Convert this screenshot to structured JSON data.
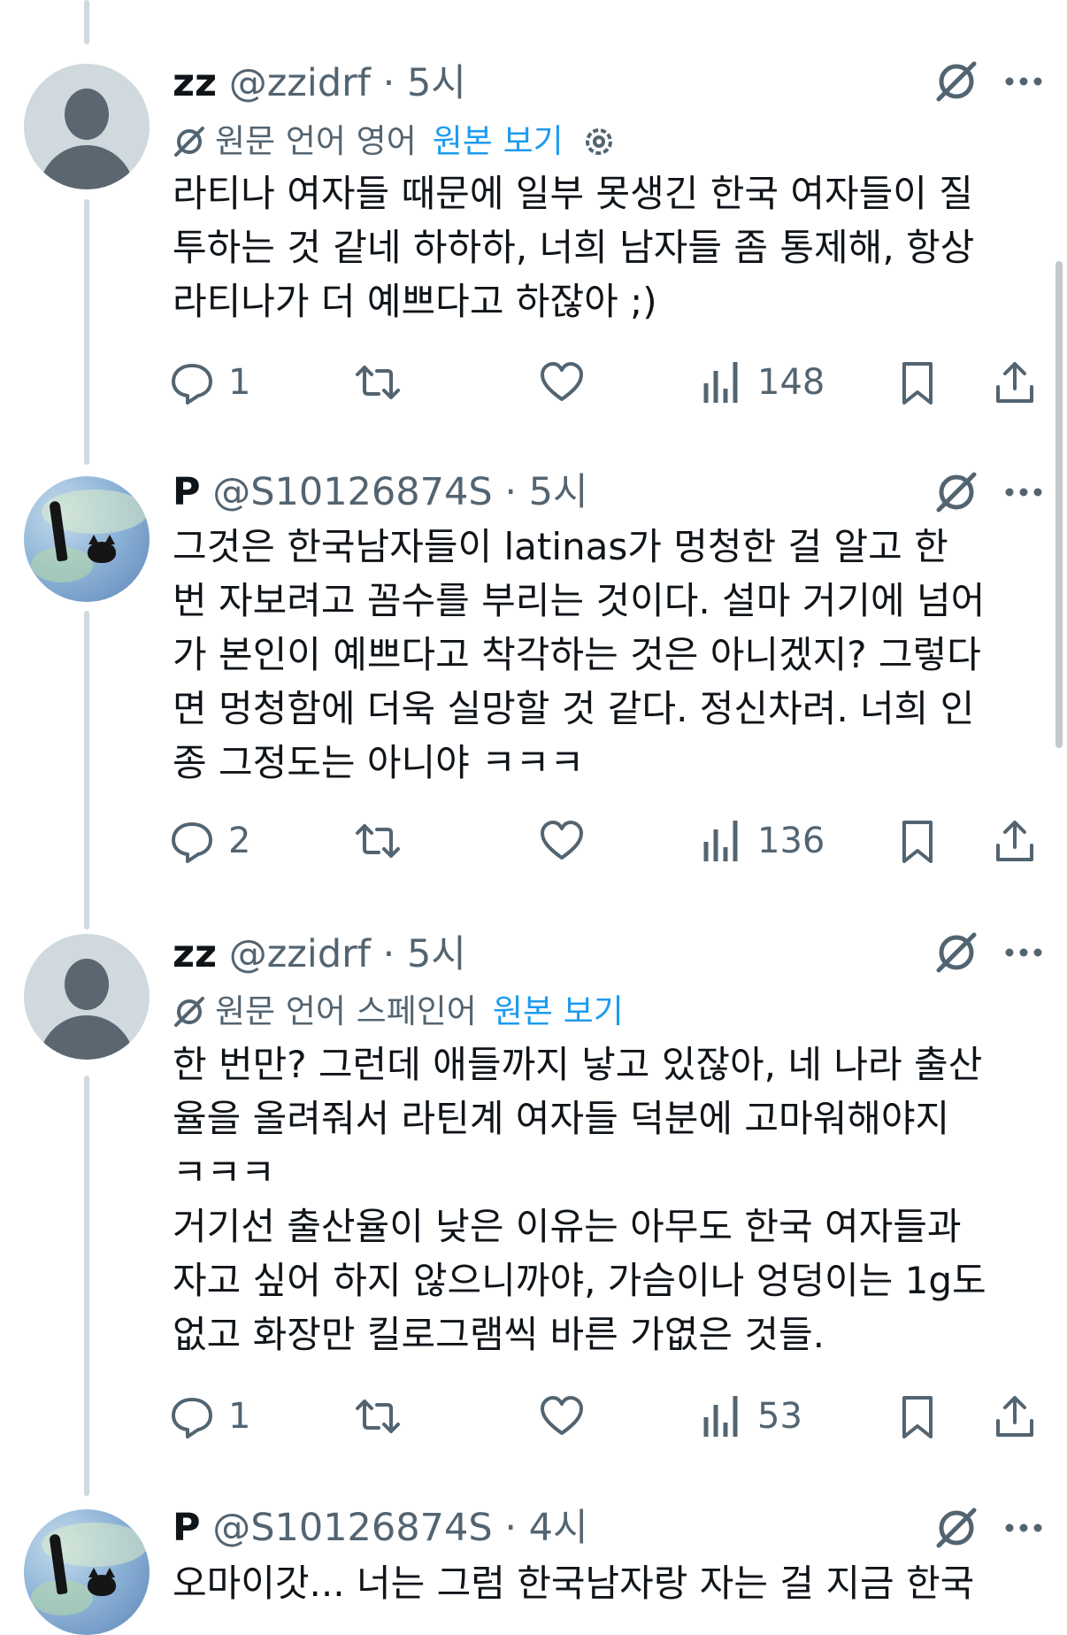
{
  "tweets": [
    {
      "name": "zz",
      "handle": "@zzidrf",
      "dot": "·",
      "time": "5시",
      "translation": {
        "label": "원문 언어 영어",
        "link": "원본 보기",
        "settings": true
      },
      "lines": [
        "라티나 여자들 때문에 일부 못생긴 한국 여자들이 질",
        "투하는 것 같네 하하하, 너희 남자들 좀 통제해, 항상",
        "라티나가 더 예쁘다고 하잖아 ;)"
      ],
      "replies": "1",
      "views": "148"
    },
    {
      "name": "P",
      "handle": "@S10126874S",
      "dot": "·",
      "time": "5시",
      "lines": [
        "그것은 한국남자들이 latinas가 멍청한 걸 알고 한",
        "번 자보려고 꼼수를 부리는 것이다. 설마 거기에 넘어",
        "가 본인이 예쁘다고 착각하는 것은 아니겠지? 그렇다",
        "면 멍청함에 더욱 실망할 것 같다. 정신차려. 너희 인",
        "종 그정도는 아니야 ㅋㅋㅋ"
      ],
      "replies": "2",
      "views": "136"
    },
    {
      "name": "zz",
      "handle": "@zzidrf",
      "dot": "·",
      "time": "5시",
      "translation": {
        "label": "원문 언어 스페인어",
        "link": "원본 보기",
        "settings": false
      },
      "lines": [
        "한 번만? 그런데 애들까지 낳고 있잖아, 네 나라 출산",
        "율을 올려줘서 라틴계 여자들 덕분에 고마워해야지",
        "ㅋㅋㅋ",
        "거기선 출산율이 낮은 이유는 아무도 한국 여자들과",
        "자고 싶어 하지 않으니까야, 가슴이나 엉덩이는 1g도",
        "없고 화장만 킬로그램씩 바른 가엾은 것들."
      ],
      "replies": "1",
      "views": "53"
    },
    {
      "name": "P",
      "handle": "@S10126874S",
      "dot": "·",
      "time": "4시",
      "lines": [
        "오마이갓... 너는 그럼 한국남자랑 자는 걸 지금 한국"
      ]
    }
  ],
  "icons": {
    "reply": "reply-bubble-icon",
    "retweet": "retweet-icon",
    "like": "heart-icon",
    "views": "views-bar-chart-icon",
    "bookmark": "bookmark-icon",
    "share": "share-upload-icon",
    "grok": "grok-icon",
    "more": "more-dots-icon",
    "translate": "translate-slash-icon",
    "settings": "gear-icon"
  },
  "colors": {
    "link": "#1d9bf0",
    "muted": "#536471",
    "thread": "#cfd9de",
    "text": "#0f1419"
  }
}
